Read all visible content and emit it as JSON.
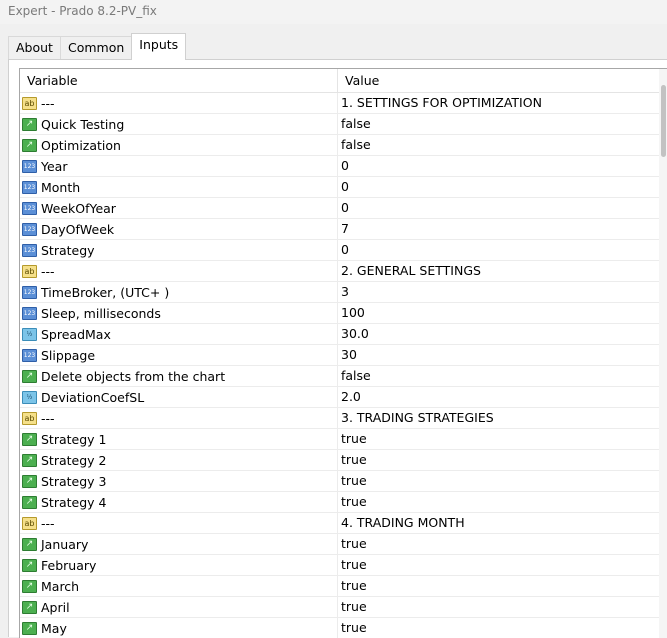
{
  "window": {
    "title": "Expert - Prado 8.2-PV_fix"
  },
  "tabs": [
    {
      "label": "About",
      "active": false
    },
    {
      "label": "Common",
      "active": false
    },
    {
      "label": "Inputs",
      "active": true
    }
  ],
  "table": {
    "columns": [
      "Variable",
      "Value"
    ],
    "rows": [
      {
        "type": "string",
        "icon": "ab",
        "variable": "---",
        "value": "1. SETTINGS FOR OPTIMIZATION"
      },
      {
        "type": "bool",
        "icon": "bool",
        "variable": "Quick Testing",
        "value": "false"
      },
      {
        "type": "bool",
        "icon": "bool",
        "variable": "Optimization",
        "value": "false"
      },
      {
        "type": "int",
        "icon": "123",
        "variable": "Year",
        "value": "0"
      },
      {
        "type": "int",
        "icon": "123",
        "variable": "Month",
        "value": "0"
      },
      {
        "type": "int",
        "icon": "123",
        "variable": "WeekOfYear",
        "value": "0"
      },
      {
        "type": "int",
        "icon": "123",
        "variable": "DayOfWeek",
        "value": "7"
      },
      {
        "type": "int",
        "icon": "123",
        "variable": "Strategy",
        "value": "0"
      },
      {
        "type": "string",
        "icon": "ab",
        "variable": "---",
        "value": "2. GENERAL SETTINGS"
      },
      {
        "type": "int",
        "icon": "123",
        "variable": "TimeBroker, (UTC+ )",
        "value": "3"
      },
      {
        "type": "int",
        "icon": "123",
        "variable": "Sleep, milliseconds",
        "value": "100"
      },
      {
        "type": "double",
        "icon": "1/2",
        "variable": "SpreadMax",
        "value": "30.0"
      },
      {
        "type": "int",
        "icon": "123",
        "variable": "Slippage",
        "value": "30"
      },
      {
        "type": "bool",
        "icon": "bool",
        "variable": "Delete objects from the chart",
        "value": "false"
      },
      {
        "type": "double",
        "icon": "1/2",
        "variable": "DeviationCoefSL",
        "value": "2.0"
      },
      {
        "type": "string",
        "icon": "ab",
        "variable": "---",
        "value": "3. TRADING STRATEGIES"
      },
      {
        "type": "bool",
        "icon": "bool",
        "variable": "Strategy 1",
        "value": "true"
      },
      {
        "type": "bool",
        "icon": "bool",
        "variable": "Strategy 2",
        "value": "true"
      },
      {
        "type": "bool",
        "icon": "bool",
        "variable": "Strategy 3",
        "value": "true"
      },
      {
        "type": "bool",
        "icon": "bool",
        "variable": "Strategy 4",
        "value": "true"
      },
      {
        "type": "string",
        "icon": "ab",
        "variable": "---",
        "value": "4. TRADING MONTH"
      },
      {
        "type": "bool",
        "icon": "bool",
        "variable": "January",
        "value": "true"
      },
      {
        "type": "bool",
        "icon": "bool",
        "variable": "February",
        "value": "true"
      },
      {
        "type": "bool",
        "icon": "bool",
        "variable": "March",
        "value": "true"
      },
      {
        "type": "bool",
        "icon": "bool",
        "variable": "April",
        "value": "true"
      },
      {
        "type": "bool",
        "icon": "bool",
        "variable": "May",
        "value": "true"
      }
    ]
  }
}
